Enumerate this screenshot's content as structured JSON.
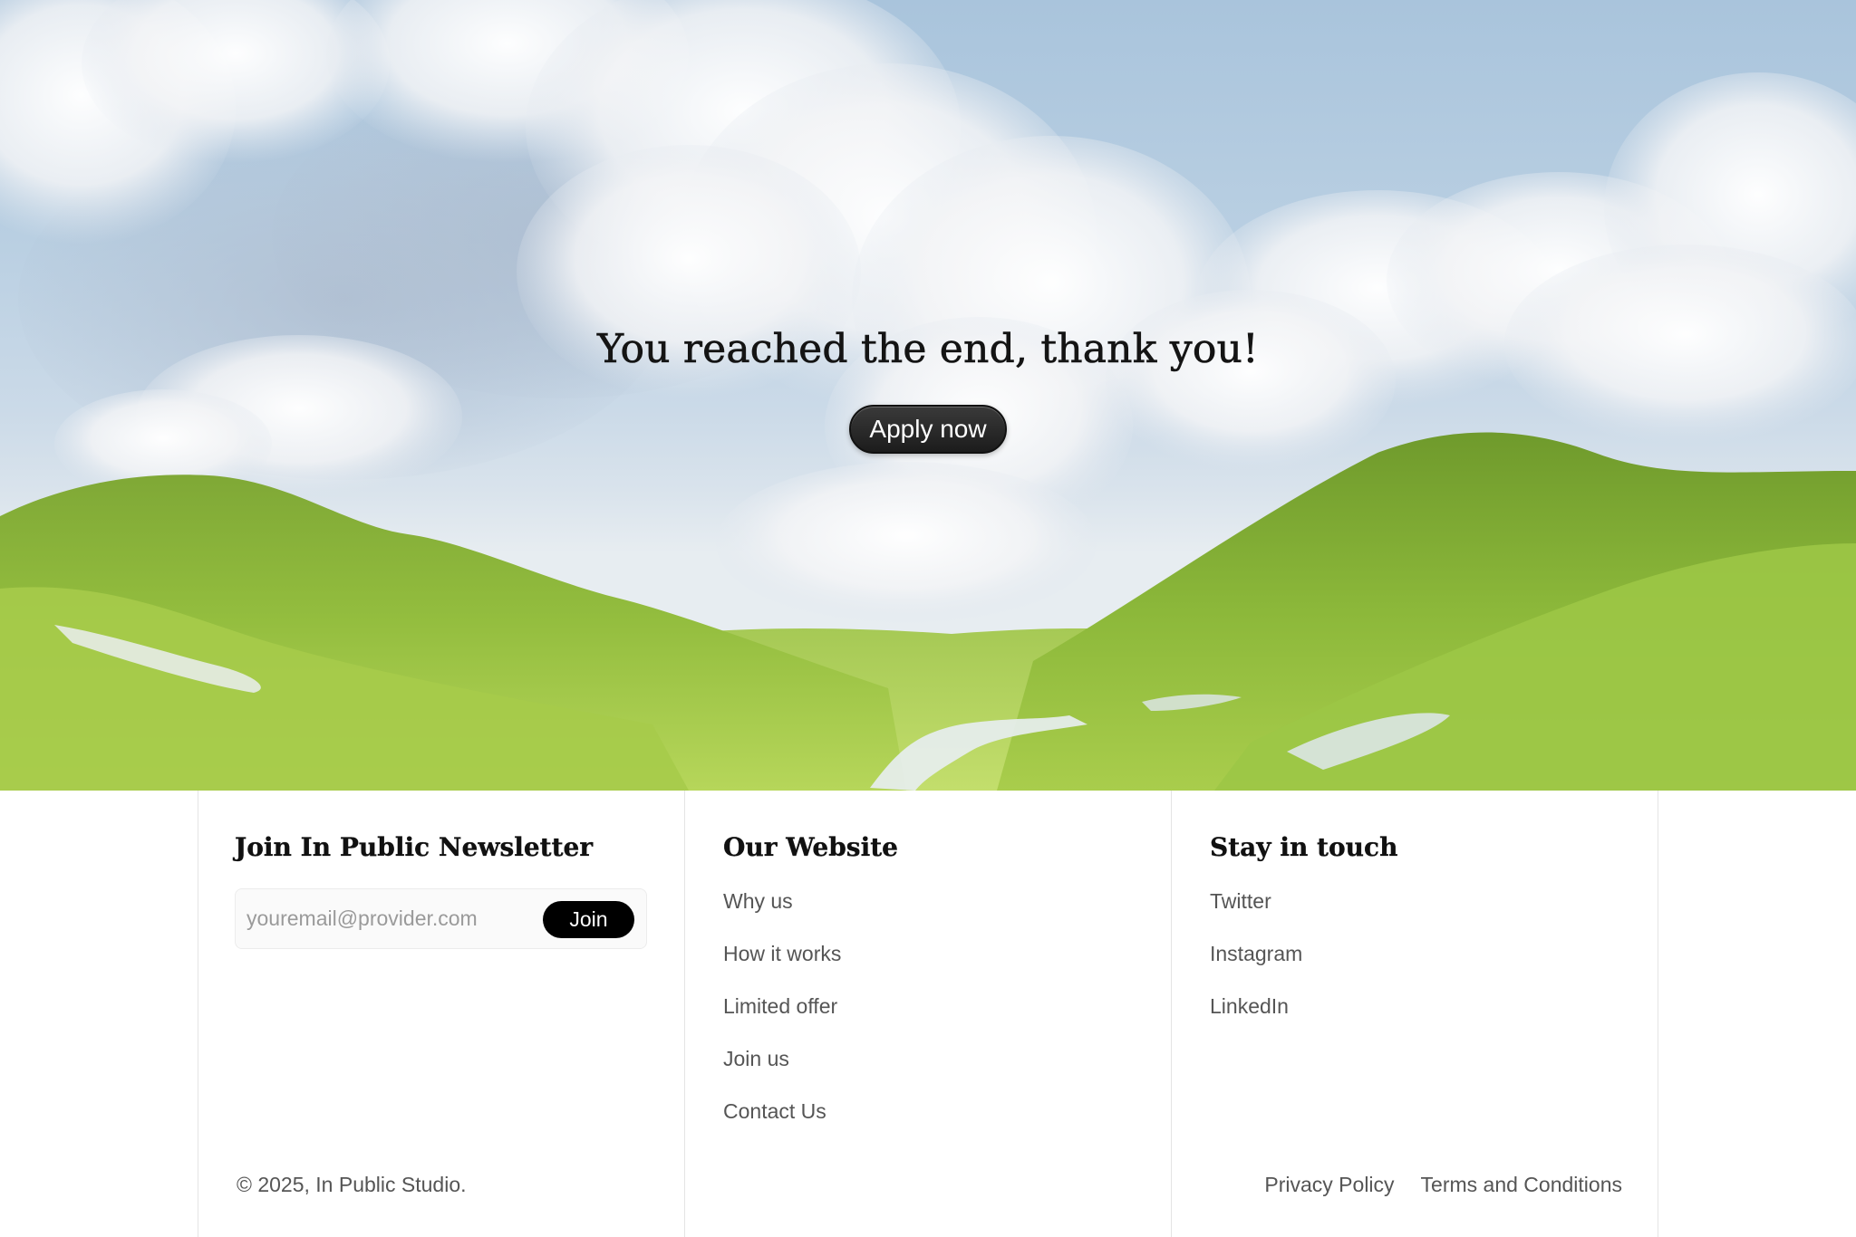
{
  "hero": {
    "title": "You reached the end, thank you!",
    "cta_label": "Apply now",
    "background": "grassy-hills-cloudy-sky-image"
  },
  "newsletter": {
    "heading": "Join In Public Newsletter",
    "email_placeholder": "youremail@provider.com",
    "join_label": "Join"
  },
  "website": {
    "heading": "Our Website",
    "links": [
      "Why us",
      "How it works",
      "Limited offer",
      "Join us",
      "Contact Us"
    ]
  },
  "social": {
    "heading": "Stay in touch",
    "links": [
      "Twitter",
      "Instagram",
      "LinkedIn"
    ]
  },
  "legal": {
    "copyright": "© 2025, In Public Studio.",
    "privacy": "Privacy Policy",
    "terms": "Terms and Conditions"
  },
  "colors": {
    "button_dark": "#1c1c1c",
    "text_muted": "#555555",
    "grass": "#8db63a",
    "sky": "#b9cfe2"
  }
}
